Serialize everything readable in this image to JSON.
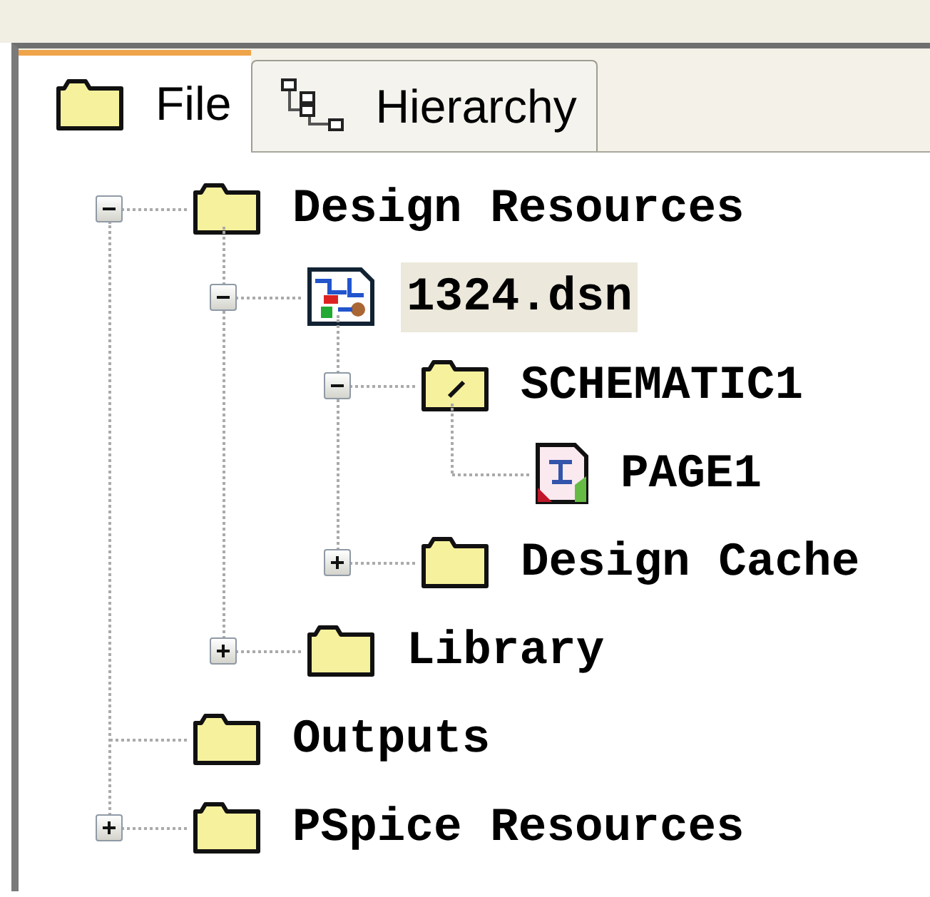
{
  "tabs": [
    {
      "label": "File",
      "kind": "folder",
      "selected": true
    },
    {
      "label": "Hierarchy",
      "kind": "hierarchy",
      "selected": false
    }
  ],
  "tree": [
    {
      "label": "Design Resources",
      "kind": "folder",
      "expanded": true,
      "selected": false,
      "children": [
        {
          "label": "1324.dsn",
          "kind": "design",
          "expanded": true,
          "selected": true,
          "children": [
            {
              "label": "SCHEMATIC1",
              "kind": "schematic",
              "expanded": true,
              "selected": false,
              "children": [
                {
                  "label": "PAGE1",
                  "kind": "page",
                  "selected": false
                }
              ]
            },
            {
              "label": "Design Cache",
              "kind": "folder",
              "expanded": false,
              "selected": false
            }
          ]
        },
        {
          "label": "Library",
          "kind": "folder",
          "expanded": false,
          "selected": false
        }
      ]
    },
    {
      "label": "Outputs",
      "kind": "folder",
      "selected": false
    },
    {
      "label": "PSpice Resources",
      "kind": "folder",
      "expanded": false,
      "selected": false
    }
  ]
}
